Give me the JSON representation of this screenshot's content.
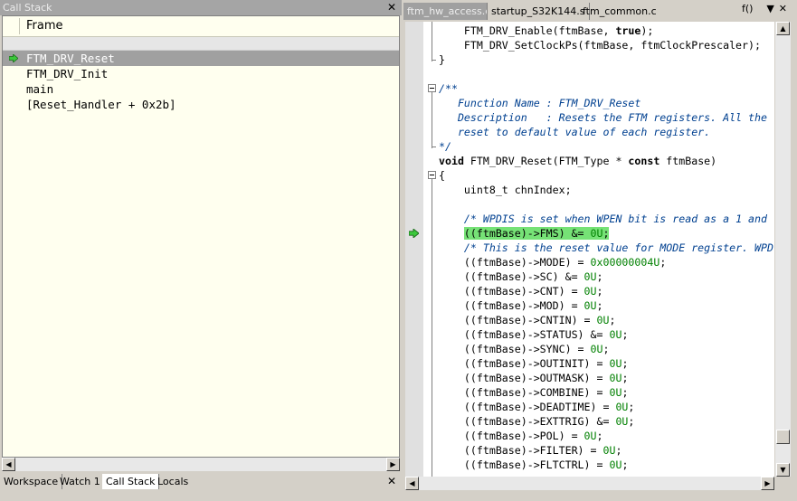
{
  "call_stack": {
    "title": "Call Stack",
    "column_header": "Frame",
    "frames": [
      {
        "label": "FTM_DRV_Reset"
      },
      {
        "label": "FTM_DRV_Init"
      },
      {
        "label": "main"
      },
      {
        "label": "[Reset_Handler + 0x2b]"
      }
    ],
    "bottom_tabs": [
      "Workspace",
      "Watch 1",
      "Call Stack",
      "Locals"
    ]
  },
  "editor": {
    "tabs": [
      "ftm_hw_access.c",
      "startup_S32K144.s",
      "ftm_common.c"
    ],
    "function_menu": "f()",
    "code": [
      {
        "segments": [
          {
            "t": "    FTM_DRV_Enable(ftmBase, "
          },
          {
            "t": "true",
            "c": "kw"
          },
          {
            "t": ");"
          }
        ]
      },
      {
        "segments": [
          {
            "t": "    FTM_DRV_SetClockPs(ftmBase, ftmClockPrescaler);"
          }
        ]
      },
      {
        "segments": [
          {
            "t": "}"
          }
        ]
      },
      {
        "segments": [
          {
            "t": ""
          }
        ]
      },
      {
        "segments": [
          {
            "t": "/**",
            "c": "cmt"
          }
        ]
      },
      {
        "segments": [
          {
            "t": "   Function Name : FTM_DRV_Reset",
            "c": "cmt"
          }
        ]
      },
      {
        "segments": [
          {
            "t": "   Description   : Resets the FTM registers. All the",
            "c": "cmt"
          }
        ]
      },
      {
        "segments": [
          {
            "t": "   reset to default value of each register.",
            "c": "cmt"
          }
        ]
      },
      {
        "segments": [
          {
            "t": "*/",
            "c": "cmt"
          }
        ]
      },
      {
        "segments": [
          {
            "t": "void",
            "c": "kw"
          },
          {
            "t": " FTM_DRV_Reset(FTM_Type * "
          },
          {
            "t": "const",
            "c": "kw"
          },
          {
            "t": " ftmBase)"
          }
        ]
      },
      {
        "segments": [
          {
            "t": "{"
          }
        ]
      },
      {
        "segments": [
          {
            "t": "    uint8_t chnIndex;"
          }
        ]
      },
      {
        "segments": [
          {
            "t": ""
          }
        ]
      },
      {
        "segments": [
          {
            "t": "    "
          },
          {
            "t": "/* WPDIS is set when WPEN bit is read as a 1 and",
            "c": "cmt"
          }
        ]
      },
      {
        "segments": [
          {
            "t": "    "
          },
          {
            "t": "((ftmBase)->FMS) &= ",
            "c": "hl"
          },
          {
            "t": "0U",
            "c": "hlnum"
          },
          {
            "t": ";",
            "c": "hl"
          }
        ],
        "current": true
      },
      {
        "segments": [
          {
            "t": "    "
          },
          {
            "t": "/* This is the reset value for MODE register. WPD",
            "c": "cmt"
          }
        ]
      },
      {
        "segments": [
          {
            "t": "    ((ftmBase)->MODE) = "
          },
          {
            "t": "0x00000004U",
            "c": "num"
          },
          {
            "t": ";"
          }
        ]
      },
      {
        "segments": [
          {
            "t": "    ((ftmBase)->SC) &= "
          },
          {
            "t": "0U",
            "c": "num"
          },
          {
            "t": ";"
          }
        ]
      },
      {
        "segments": [
          {
            "t": "    ((ftmBase)->CNT) = "
          },
          {
            "t": "0U",
            "c": "num"
          },
          {
            "t": ";"
          }
        ]
      },
      {
        "segments": [
          {
            "t": "    ((ftmBase)->MOD) = "
          },
          {
            "t": "0U",
            "c": "num"
          },
          {
            "t": ";"
          }
        ]
      },
      {
        "segments": [
          {
            "t": "    ((ftmBase)->CNTIN) = "
          },
          {
            "t": "0U",
            "c": "num"
          },
          {
            "t": ";"
          }
        ]
      },
      {
        "segments": [
          {
            "t": "    ((ftmBase)->STATUS) &= "
          },
          {
            "t": "0U",
            "c": "num"
          },
          {
            "t": ";"
          }
        ]
      },
      {
        "segments": [
          {
            "t": "    ((ftmBase)->SYNC) = "
          },
          {
            "t": "0U",
            "c": "num"
          },
          {
            "t": ";"
          }
        ]
      },
      {
        "segments": [
          {
            "t": "    ((ftmBase)->OUTINIT) = "
          },
          {
            "t": "0U",
            "c": "num"
          },
          {
            "t": ";"
          }
        ]
      },
      {
        "segments": [
          {
            "t": "    ((ftmBase)->OUTMASK) = "
          },
          {
            "t": "0U",
            "c": "num"
          },
          {
            "t": ";"
          }
        ]
      },
      {
        "segments": [
          {
            "t": "    ((ftmBase)->COMBINE) = "
          },
          {
            "t": "0U",
            "c": "num"
          },
          {
            "t": ";"
          }
        ]
      },
      {
        "segments": [
          {
            "t": "    ((ftmBase)->DEADTIME) = "
          },
          {
            "t": "0U",
            "c": "num"
          },
          {
            "t": ";"
          }
        ]
      },
      {
        "segments": [
          {
            "t": "    ((ftmBase)->EXTTRIG) &= "
          },
          {
            "t": "0U",
            "c": "num"
          },
          {
            "t": ";"
          }
        ]
      },
      {
        "segments": [
          {
            "t": "    ((ftmBase)->POL) = "
          },
          {
            "t": "0U",
            "c": "num"
          },
          {
            "t": ";"
          }
        ]
      },
      {
        "segments": [
          {
            "t": "    ((ftmBase)->FILTER) = "
          },
          {
            "t": "0U",
            "c": "num"
          },
          {
            "t": ";"
          }
        ]
      },
      {
        "segments": [
          {
            "t": "    ((ftmBase)->FLTCTRL) = "
          },
          {
            "t": "0U",
            "c": "num"
          },
          {
            "t": ";"
          }
        ]
      }
    ]
  },
  "colors": {
    "current_line": "#76e276",
    "comment": "#004090",
    "number": "#008000",
    "arrow": "#3cc83c"
  }
}
